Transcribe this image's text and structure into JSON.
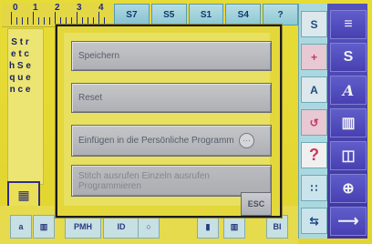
{
  "ruler": {
    "numbers": [
      "0",
      "1",
      "2",
      "3",
      "4"
    ]
  },
  "top_tabs": [
    "S7",
    "S5",
    "S1",
    "S4",
    "?"
  ],
  "left_panel": {
    "label": "S\nt\nr\ne\nt\nc\nh\n \nS\ne\nq\nu\ne\nn\nc\ne",
    "icon": "grid-icon"
  },
  "modal": {
    "items": [
      {
        "label": "Speichern"
      },
      {
        "label": "Reset"
      },
      {
        "label": "Einfügen in die Persönliche Programm"
      },
      {
        "label": "Stitch ausrufen Einzeln ausrufen Programmieren"
      }
    ],
    "esc_label": "ESC"
  },
  "right_column_1": [
    "S",
    "+",
    "A",
    "↺",
    "?",
    "∷",
    "⇆"
  ],
  "right_column_2": [
    "≡",
    "S",
    "A",
    "▥",
    "◫",
    "⊕",
    "⟶"
  ],
  "bottom_bar": [
    "a",
    "▥",
    "PMH",
    "ID",
    "○",
    "▮",
    "▥",
    "BI"
  ],
  "colors": {
    "accent_yellow": "#f2e234",
    "accent_blue": "#96d6e2",
    "accent_purple": "#4d44bd",
    "modal_button_gray": "#c0c2c7"
  }
}
